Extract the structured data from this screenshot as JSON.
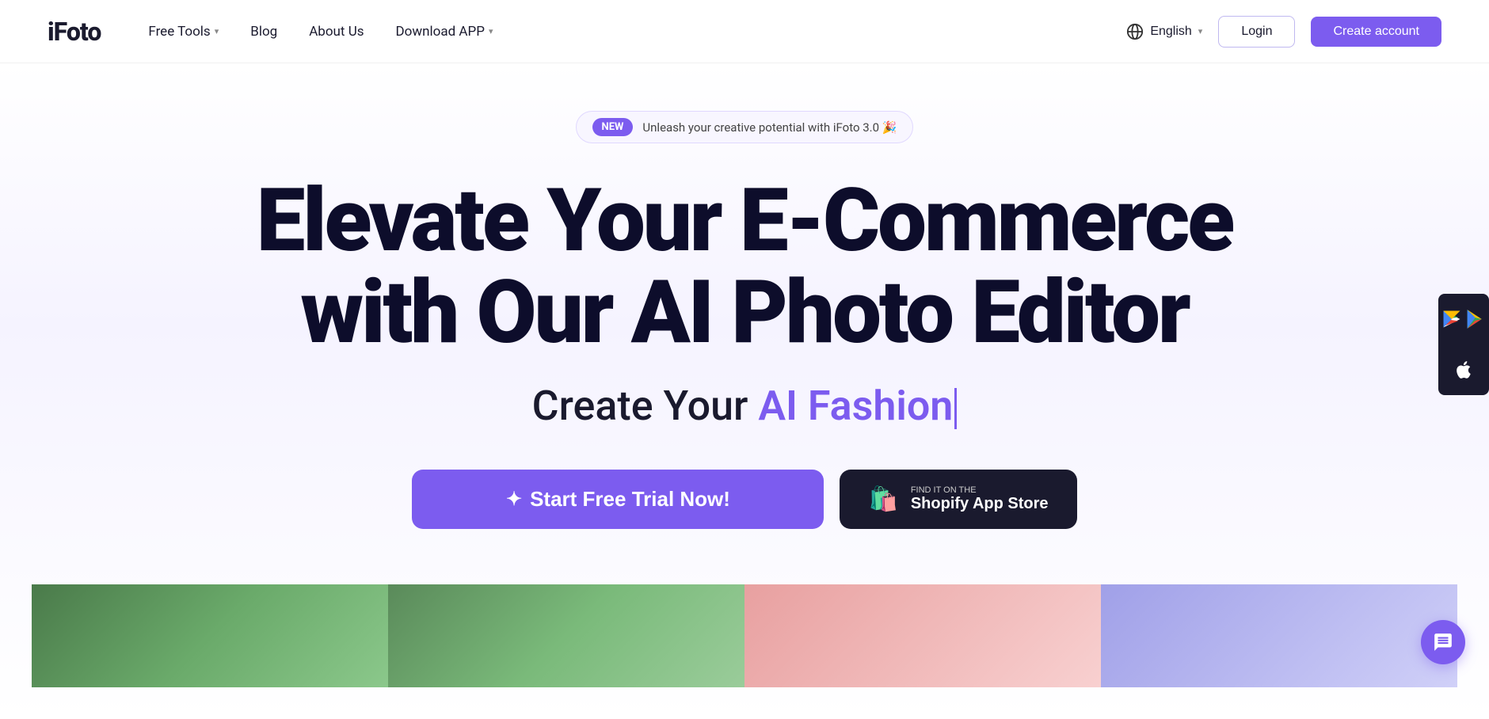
{
  "logo": {
    "text_i": "i",
    "text_foto": "Foto"
  },
  "nav": {
    "free_tools_label": "Free Tools",
    "blog_label": "Blog",
    "about_us_label": "About Us",
    "download_app_label": "Download APP",
    "language_label": "English",
    "login_label": "Login",
    "create_account_label": "Create account"
  },
  "hero": {
    "badge_new": "NEW",
    "badge_text": "Unleash your creative potential with iFoto 3.0 🎉",
    "title_line1": "Elevate Your E-Commerce",
    "title_line2": "with Our AI Photo Editor",
    "subtitle_static": "Create Your ",
    "subtitle_accent": "AI Fashion",
    "trial_btn_label": "Start Free Trial Now!",
    "shopify_find_label": "FIND IT ON THE",
    "shopify_store_label": "Shopify App Store"
  },
  "side_buttons": {
    "android_label": "Android App",
    "ios_label": "iOS App"
  },
  "chat_btn": {
    "label": "Chat"
  }
}
